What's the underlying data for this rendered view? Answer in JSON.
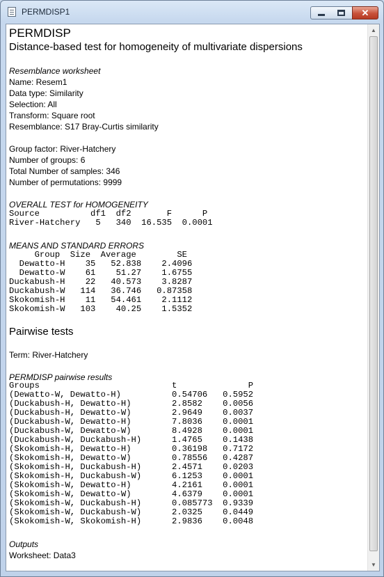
{
  "window": {
    "title": "PERMDISP1",
    "close_glyph": "✕"
  },
  "doc": {
    "heading": "PERMDISP",
    "subheading": "Distance-based test for homogeneity of multivariate dispersions",
    "resemblance": {
      "title": "Resemblance worksheet",
      "lines": [
        "Name: Resem1",
        "Data type: Similarity",
        "Selection: All",
        "Transform: Square root",
        "Resemblance: S17 Bray-Curtis similarity"
      ]
    },
    "group_info": [
      "Group factor: River-Hatchery",
      "Number of groups: 6",
      "Total Number of samples: 346",
      "Number of permutations: 9999"
    ],
    "overall": {
      "title": "OVERALL TEST for HOMOGENEITY",
      "header": "Source          df1  df2       F      P",
      "row": "River-Hatchery   5   340  16.535  0.0001"
    },
    "means": {
      "title": "MEANS AND STANDARD ERRORS",
      "header": "     Group  Size  Average        SE",
      "rows": [
        "  Dewatto-H    35   52.838    2.4096",
        "  Dewatto-W    61    51.27    1.6755",
        "Duckabush-H    22   40.573    3.8287",
        "Duckabush-W   114   36.746   0.87358",
        "Skokomish-H    11   54.461    2.1112",
        "Skokomish-W   103    40.25    1.5352"
      ]
    },
    "pairwise_heading": "Pairwise tests",
    "term": "Term: River-Hatchery",
    "pairwise": {
      "title": "PERMDISP pairwise results",
      "header": "Groups                          t              P",
      "rows": [
        "(Dewatto-W, Dewatto-H)          0.54706   0.5952",
        "(Duckabush-H, Dewatto-H)        2.8582    0.0056",
        "(Duckabush-H, Dewatto-W)        2.9649    0.0037",
        "(Duckabush-W, Dewatto-H)        7.8036    0.0001",
        "(Duckabush-W, Dewatto-W)        8.4928    0.0001",
        "(Duckabush-W, Duckabush-H)      1.4765    0.1438",
        "(Skokomish-H, Dewatto-H)        0.36198   0.7172",
        "(Skokomish-H, Dewatto-W)        0.78556   0.4287",
        "(Skokomish-H, Duckabush-H)      2.4571    0.0203",
        "(Skokomish-H, Duckabush-W)      6.1253    0.0001",
        "(Skokomish-W, Dewatto-H)        4.2161    0.0001",
        "(Skokomish-W, Dewatto-W)        4.6379    0.0001",
        "(Skokomish-W, Duckabush-H)      0.085773  0.9339",
        "(Skokomish-W, Duckabush-W)      2.0325    0.0449",
        "(Skokomish-W, Skokomish-H)      2.9836    0.0048"
      ]
    },
    "outputs": {
      "title": "Outputs",
      "worksheet": "Worksheet: Data3"
    }
  }
}
